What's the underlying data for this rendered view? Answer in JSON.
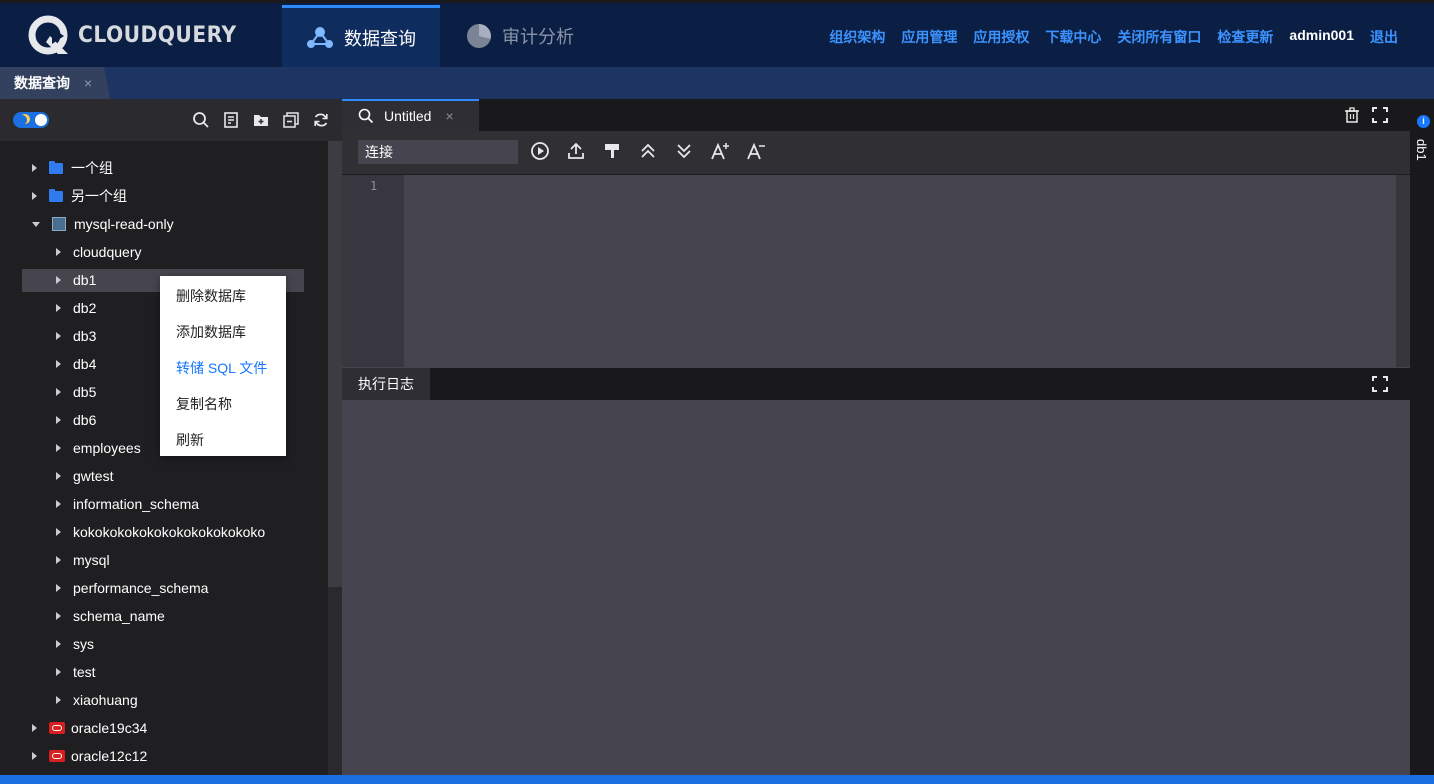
{
  "header": {
    "brand": "CLOUDQUERY",
    "nav": {
      "query": "数据查询",
      "audit": "审计分析"
    },
    "links": [
      "组织架构",
      "应用管理",
      "应用授权",
      "下载中心",
      "关闭所有窗口",
      "检查更新"
    ],
    "user": "admin001",
    "logout": "退出"
  },
  "page_tab": {
    "label": "数据查询",
    "close": "×"
  },
  "sidebar": {
    "icons": [
      "search-icon",
      "new-query-icon",
      "new-folder-icon",
      "collapse-all-icon",
      "refresh-icon"
    ],
    "tree": [
      {
        "label": "一个组",
        "type": "folder",
        "level": 0,
        "expanded": false
      },
      {
        "label": "另一个组",
        "type": "folder",
        "level": 0,
        "expanded": false
      },
      {
        "label": "mysql-read-only",
        "type": "connection",
        "level": 0,
        "expanded": true
      },
      {
        "label": "cloudquery",
        "type": "database",
        "level": 1
      },
      {
        "label": "db1",
        "type": "database",
        "level": 1,
        "selected": true
      },
      {
        "label": "db2",
        "type": "database",
        "level": 1
      },
      {
        "label": "db3",
        "type": "database",
        "level": 1
      },
      {
        "label": "db4",
        "type": "database",
        "level": 1
      },
      {
        "label": "db5",
        "type": "database",
        "level": 1
      },
      {
        "label": "db6",
        "type": "database",
        "level": 1
      },
      {
        "label": "employees",
        "type": "database",
        "level": 1
      },
      {
        "label": "gwtest",
        "type": "database",
        "level": 1
      },
      {
        "label": "information_schema",
        "type": "database",
        "level": 1
      },
      {
        "label": "kokokokokokokokokokokokoko",
        "type": "database",
        "level": 1
      },
      {
        "label": "mysql",
        "type": "database",
        "level": 1
      },
      {
        "label": "performance_schema",
        "type": "database",
        "level": 1
      },
      {
        "label": "schema_name",
        "type": "database",
        "level": 1
      },
      {
        "label": "sys",
        "type": "database",
        "level": 1
      },
      {
        "label": "test",
        "type": "database",
        "level": 1
      },
      {
        "label": "xiaohuang",
        "type": "database",
        "level": 1
      },
      {
        "label": "oracle19c34",
        "type": "oracle",
        "level": 0,
        "expanded": false
      },
      {
        "label": "oracle12c12",
        "type": "oracle",
        "level": 0,
        "expanded": false
      }
    ]
  },
  "context_menu": {
    "items": [
      {
        "label": "删除数据库",
        "active": false
      },
      {
        "label": "添加数据库",
        "active": false
      },
      {
        "label": "转储 SQL 文件",
        "active": true
      },
      {
        "label": "复制名称",
        "active": false
      },
      {
        "label": "刷新",
        "active": false
      }
    ]
  },
  "editor": {
    "tab": {
      "label": "Untitled",
      "close": "×"
    },
    "connection_placeholder": "连接",
    "toolbar_icons": [
      "run-icon",
      "upload-icon",
      "format-icon",
      "collapse-up-icon",
      "expand-down-icon",
      "font-increase-icon",
      "font-decrease-icon"
    ],
    "line_numbers": [
      "1"
    ],
    "log_tab": "执行日志"
  },
  "right_dock": {
    "label": "db1",
    "info": "i"
  },
  "colors": {
    "accent": "#1677ff",
    "header_bg": "#0b1f45",
    "link": "#3b93ff",
    "editor_bg": "#45444f"
  }
}
